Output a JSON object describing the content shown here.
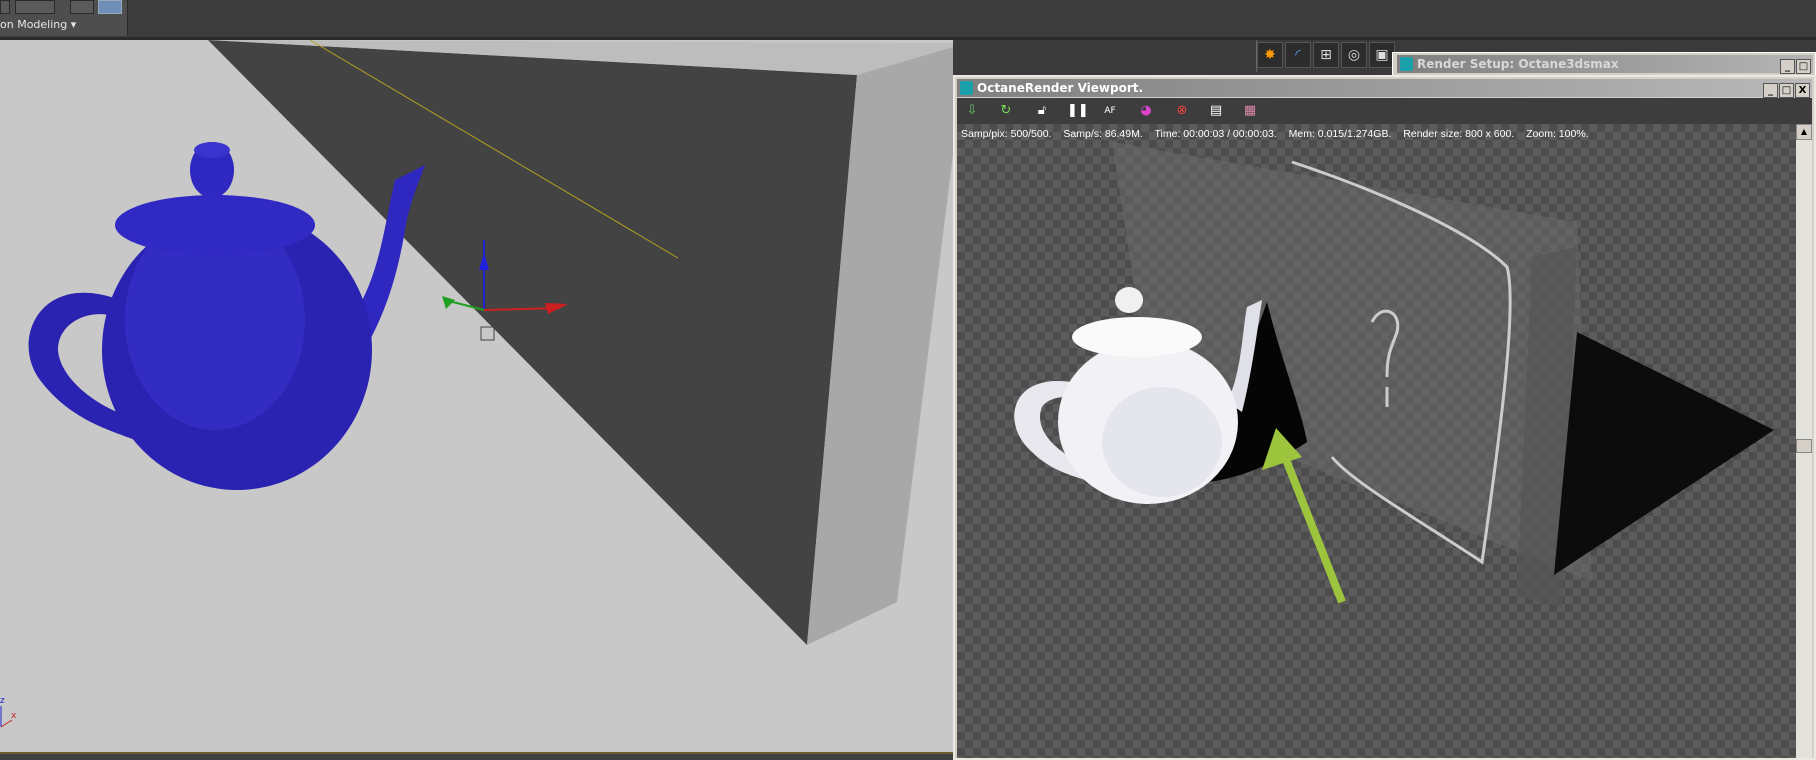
{
  "ribbon": {
    "label": "on Modeling"
  },
  "render_setup": {
    "title": "Render Setup: Octane3dsmax"
  },
  "octane": {
    "title": "OctaneRender Viewport.",
    "toolbar": [
      "save-icon",
      "refresh-icon",
      "lock-icon",
      "pause-icon",
      "af-icon",
      "color-icon",
      "cancel-icon",
      "display-icon",
      "film-icon"
    ],
    "af_label": "AF",
    "status": {
      "samp_pix": "Samp/pix: 500/500.",
      "samp_s": "Samp/s: 86.49M.",
      "time": "Time: 00:00:03 / 00:00:03.",
      "mem": "Mem: 0.015/1.274GB.",
      "render_size": "Render size: 800 x 600.",
      "zoom": "Zoom: 100%."
    }
  },
  "viewport": {
    "axis_z": "z",
    "axis_x": "x"
  },
  "window_controls": {
    "minimize": "_",
    "maximize": "□",
    "close": "X"
  },
  "colors": {
    "teapot": "#2a22b0",
    "arrow": "#9cc43c",
    "viewport_bg": "#c8c8c8"
  }
}
